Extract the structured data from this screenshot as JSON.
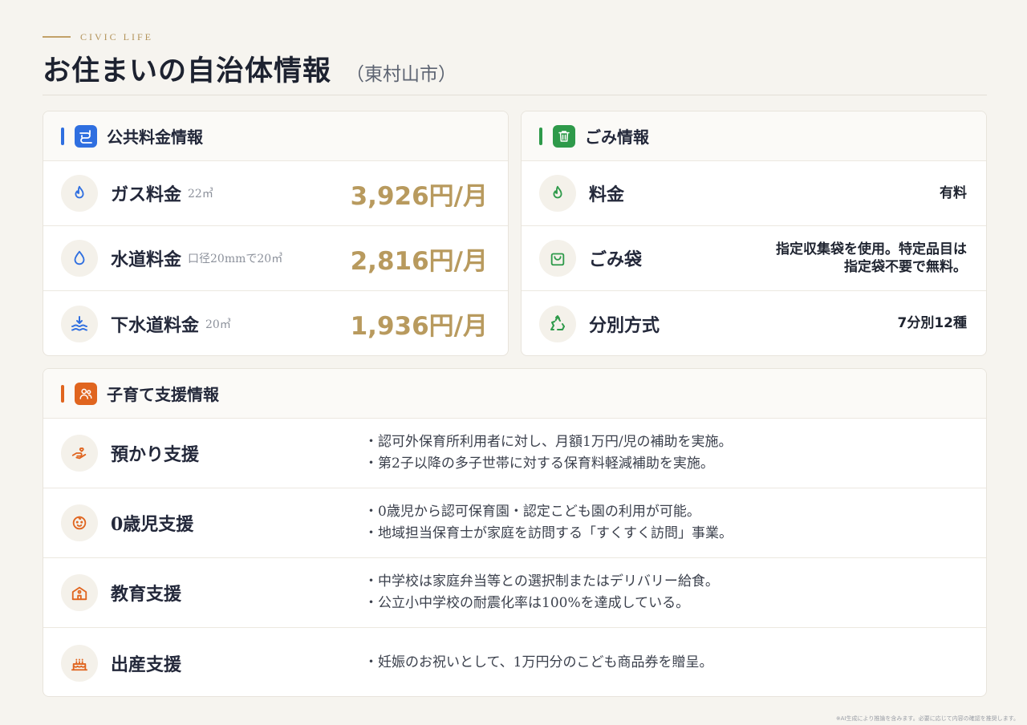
{
  "header": {
    "eyebrow": "CIVIC LIFE",
    "title": "お住まいの自治体情報",
    "subtitle": "（東村山市）"
  },
  "utilities": {
    "title": "公共料金情報",
    "accent": "#2f6fe0",
    "rows": [
      {
        "label": "ガス料金",
        "note": "22㎥",
        "value": "3,926円/月",
        "icon": "flame-icon"
      },
      {
        "label": "水道料金",
        "note": "口径20mmで20㎥",
        "value": "2,816円/月",
        "icon": "water-drop-icon"
      },
      {
        "label": "下水道料金",
        "note": "20㎥",
        "value": "1,936円/月",
        "icon": "sewer-wave-icon"
      }
    ]
  },
  "garbage": {
    "title": "ごみ情報",
    "accent": "#2e9a4a",
    "rows": [
      {
        "label": "料金",
        "value": "有料",
        "icon": "flame-icon"
      },
      {
        "label": "ごみ袋",
        "value_line1": "指定収集袋を使用。特定品目は",
        "value_line2": "指定袋不要で無料。",
        "icon": "shopping-bag-icon"
      },
      {
        "label": "分別方式",
        "value": "7分別12種",
        "icon": "recycle-icon"
      }
    ]
  },
  "childcare": {
    "title": "子育て支援情報",
    "accent": "#e0651f",
    "rows": [
      {
        "label": "預かり支援",
        "lines": [
          "・認可外保育所利用者に対し、月額1万円/児の補助を実施。",
          "・第2子以降の多子世帯に対する保育料軽減補助を実施。"
        ],
        "icon": "hand-heart-icon"
      },
      {
        "label": "0歳児支援",
        "lines": [
          "・0歳児から認可保育園・認定こども園の利用が可能。",
          "・地域担当保育士が家庭を訪問する「すくすく訪問」事業。"
        ],
        "icon": "baby-icon"
      },
      {
        "label": "教育支援",
        "lines": [
          "・中学校は家庭弁当等との選択制またはデリバリー給食。",
          "・公立小中学校の耐震化率は100%を達成している。"
        ],
        "icon": "school-icon"
      },
      {
        "label": "出産支援",
        "lines": [
          "・妊娠のお祝いとして、1万円分のこども商品券を贈呈。"
        ],
        "icon": "cake-icon"
      }
    ]
  },
  "footnote": "※AI生成により推論を含みます。必要に応じて内容の確認を推奨します。"
}
